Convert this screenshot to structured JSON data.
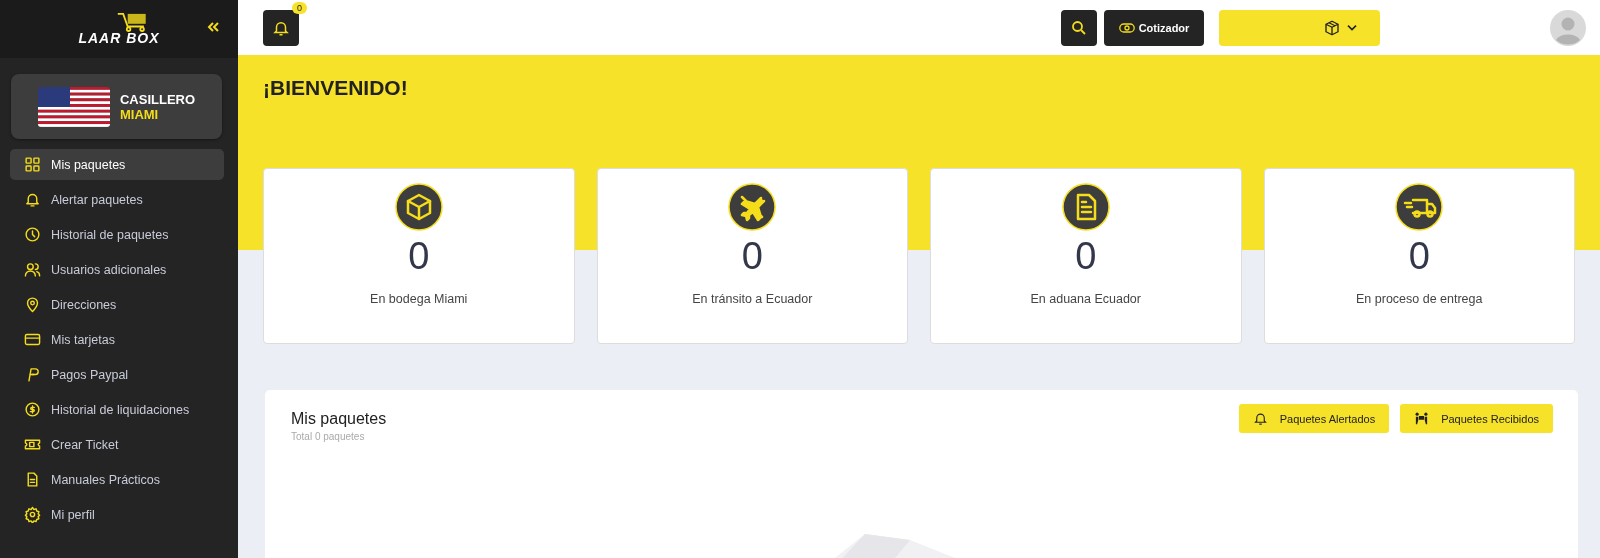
{
  "sidebar": {
    "logo": {
      "word_1": "LAAR",
      "word_2": "BOX"
    },
    "locker": {
      "title": "CASILLERO",
      "city": "MIAMI"
    },
    "items": [
      {
        "label": "Mis paquetes",
        "kind": "grid",
        "selected": true
      },
      {
        "label": "Alertar paquetes",
        "kind": "bell",
        "selected": false
      },
      {
        "label": "Historial de paquetes",
        "kind": "clock",
        "selected": false
      },
      {
        "label": "Usuarios adicionales",
        "kind": "users",
        "selected": false
      },
      {
        "label": "Direcciones",
        "kind": "pin",
        "selected": false
      },
      {
        "label": "Mis tarjetas",
        "kind": "card",
        "selected": false
      },
      {
        "label": "Pagos Paypal",
        "kind": "paypal",
        "selected": false
      },
      {
        "label": "Historial de liquidaciones",
        "kind": "coin",
        "selected": false
      },
      {
        "label": "Crear Ticket",
        "kind": "ticket",
        "selected": false
      },
      {
        "label": "Manuales Prácticos",
        "kind": "docs",
        "selected": false
      },
      {
        "label": "Mi perfil",
        "kind": "gear",
        "selected": false
      }
    ]
  },
  "topbar": {
    "notifications": "0",
    "quote_button": "Cotizador"
  },
  "welcome": "¡BIENVENIDO!",
  "stats": [
    {
      "kind": "box",
      "value": "0",
      "label": "En bodega Miami"
    },
    {
      "kind": "plane",
      "value": "0",
      "label": "En tránsito a Ecuador"
    },
    {
      "kind": "doc",
      "value": "0",
      "label": "En aduana Ecuador"
    },
    {
      "kind": "truck",
      "value": "0",
      "label": "En proceso de entrega"
    }
  ],
  "packages": {
    "title": "Mis paquetes",
    "subtitle": "Total 0 paquetes",
    "buttons": [
      {
        "label": "Paquetes Alertados",
        "kind": "bell"
      },
      {
        "label": "Paquetes Recibidos",
        "kind": "people"
      }
    ]
  }
}
